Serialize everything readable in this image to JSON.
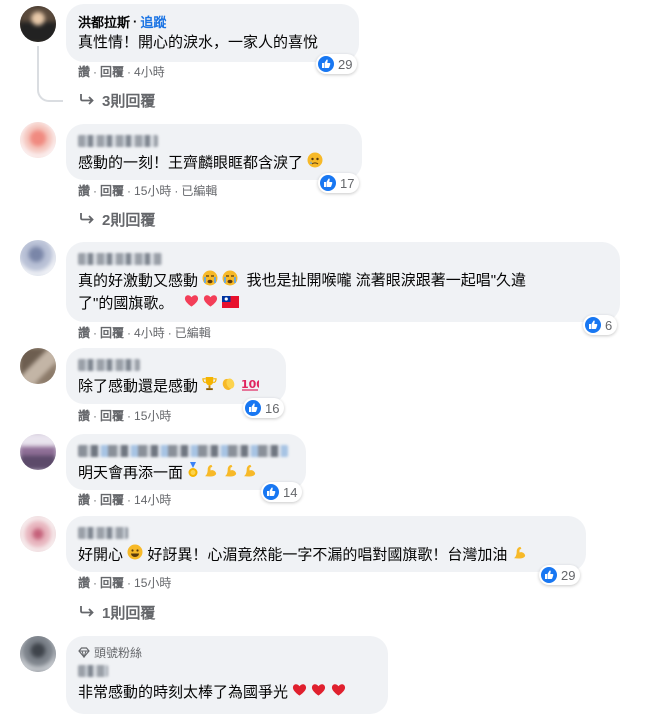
{
  "comments": [
    {
      "name": "洪都拉斯",
      "follow": "追蹤",
      "text": "真性情！開心的淚水，一家人的喜悅",
      "likes": "29",
      "actions": [
        "讚",
        "回覆",
        "4小時"
      ],
      "replies": "3則回覆"
    },
    {
      "text": "感動的一刻！王齊麟眼眶都含淚了",
      "likes": "17",
      "actions": [
        "讚",
        "回覆",
        "15小時",
        "已編輯"
      ],
      "replies": "2則回覆"
    },
    {
      "text_line1": "真的好激動又感動",
      "text_line1b": "我也是扯開喉嚨 流著眼淚跟著一起唱\"久違",
      "text_line2": "了\"的國旗歌。",
      "likes": "6",
      "actions": [
        "讚",
        "回覆",
        "4小時",
        "已編輯"
      ]
    },
    {
      "text": "除了感動還是感動",
      "likes": "16",
      "actions": [
        "讚",
        "回覆",
        "15小時"
      ]
    },
    {
      "text": "明天會再添一面",
      "likes": "14",
      "actions": [
        "讚",
        "回覆",
        "14小時"
      ]
    },
    {
      "text_a": "好開心",
      "text_b": "好訝異！心湄竟然能一字不漏的唱對國旗歌！台灣加油",
      "likes": "29",
      "actions": [
        "讚",
        "回覆",
        "15小時"
      ],
      "replies": "1則回覆"
    },
    {
      "badge": "頭號粉絲",
      "text": "非常感動的時刻太棒了為國爭光"
    }
  ],
  "colors": {
    "link_blue": "#1b74e4",
    "like_blue": "#1877f2",
    "bubble_bg": "#f0f2f5",
    "meta_gray": "#65676b"
  }
}
